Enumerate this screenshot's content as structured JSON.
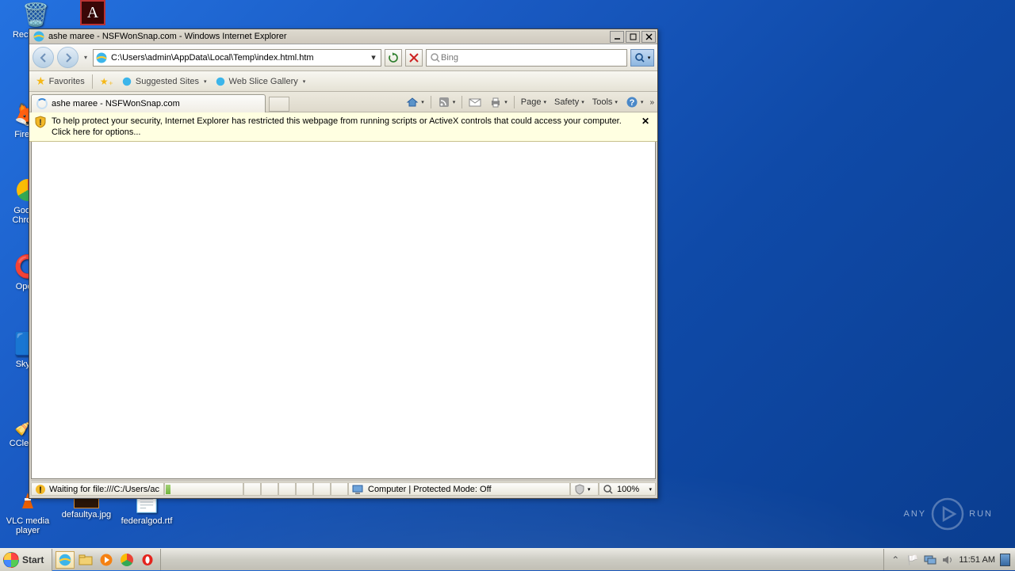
{
  "window": {
    "title": "ashe maree - NSFWonSnap.com - Windows Internet Explorer",
    "address": "C:\\Users\\admin\\AppData\\Local\\Temp\\index.html.htm",
    "search_placeholder": "Bing"
  },
  "favbar": {
    "favorites": "Favorites",
    "suggested": "Suggested Sites",
    "webslice": "Web Slice Gallery"
  },
  "tab": {
    "title": "ashe maree - NSFWonSnap.com"
  },
  "cmdbar": {
    "page": "Page",
    "safety": "Safety",
    "tools": "Tools"
  },
  "infobar": {
    "message": "To help protect your security, Internet Explorer has restricted this webpage from running scripts or ActiveX controls that could access your computer. Click here for options..."
  },
  "statusbar": {
    "status": "Waiting for file:///C:/Users/ac",
    "zone": "Computer | Protected Mode: Off",
    "zoom": "100%"
  },
  "taskbar": {
    "start": "Start",
    "clock": "11:51 AM"
  },
  "desktop": {
    "recycle": "Recycle Bin",
    "firefox": "Firefox",
    "chrome": "Google Chrome",
    "opera": "Opera",
    "skype": "Skype",
    "ccleaner": "CCleaner",
    "vlc": "VLC media player",
    "file1": "defaultya.jpg",
    "file2": "federalgod.rtf"
  },
  "watermark": {
    "text1": "ANY",
    "text2": "RUN"
  }
}
